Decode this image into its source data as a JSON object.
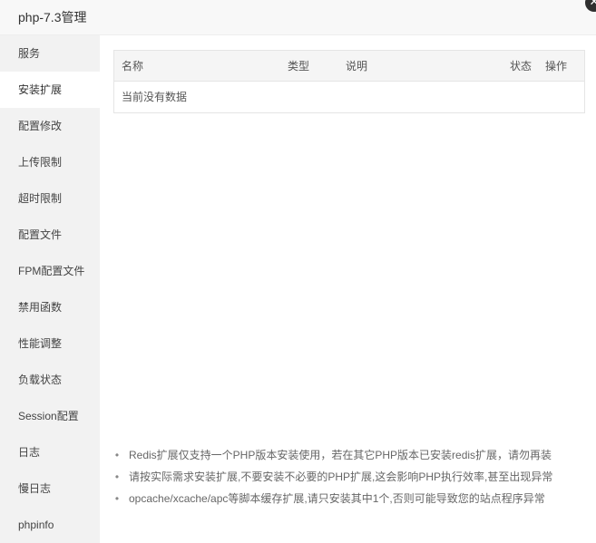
{
  "window": {
    "title": "php-7.3管理",
    "close_icon": "close-icon"
  },
  "sidebar": {
    "items": [
      {
        "label": "服务",
        "active": false
      },
      {
        "label": "安装扩展",
        "active": true
      },
      {
        "label": "配置修改",
        "active": false
      },
      {
        "label": "上传限制",
        "active": false
      },
      {
        "label": "超时限制",
        "active": false
      },
      {
        "label": "配置文件",
        "active": false
      },
      {
        "label": "FPM配置文件",
        "active": false
      },
      {
        "label": "禁用函数",
        "active": false
      },
      {
        "label": "性能调整",
        "active": false
      },
      {
        "label": "负载状态",
        "active": false
      },
      {
        "label": "Session配置",
        "active": false
      },
      {
        "label": "日志",
        "active": false
      },
      {
        "label": "慢日志",
        "active": false
      },
      {
        "label": "phpinfo",
        "active": false
      }
    ]
  },
  "table": {
    "columns": [
      "名称",
      "类型",
      "说明",
      "状态",
      "操作"
    ],
    "empty_text": "当前没有数据"
  },
  "notes": [
    "Redis扩展仅支持一个PHP版本安装使用，若在其它PHP版本已安装redis扩展，请勿再装",
    "请按实际需求安装扩展,不要安装不必要的PHP扩展,这会影响PHP执行效率,甚至出现异常",
    "opcache/xcache/apc等脚本缓存扩展,请只安装其中1个,否则可能导致您的站点程序异常"
  ],
  "colors": {
    "sidebar_bg": "#f2f2f2",
    "active_item_bg": "#ffffff",
    "table_header_bg": "#f5f5f5"
  }
}
